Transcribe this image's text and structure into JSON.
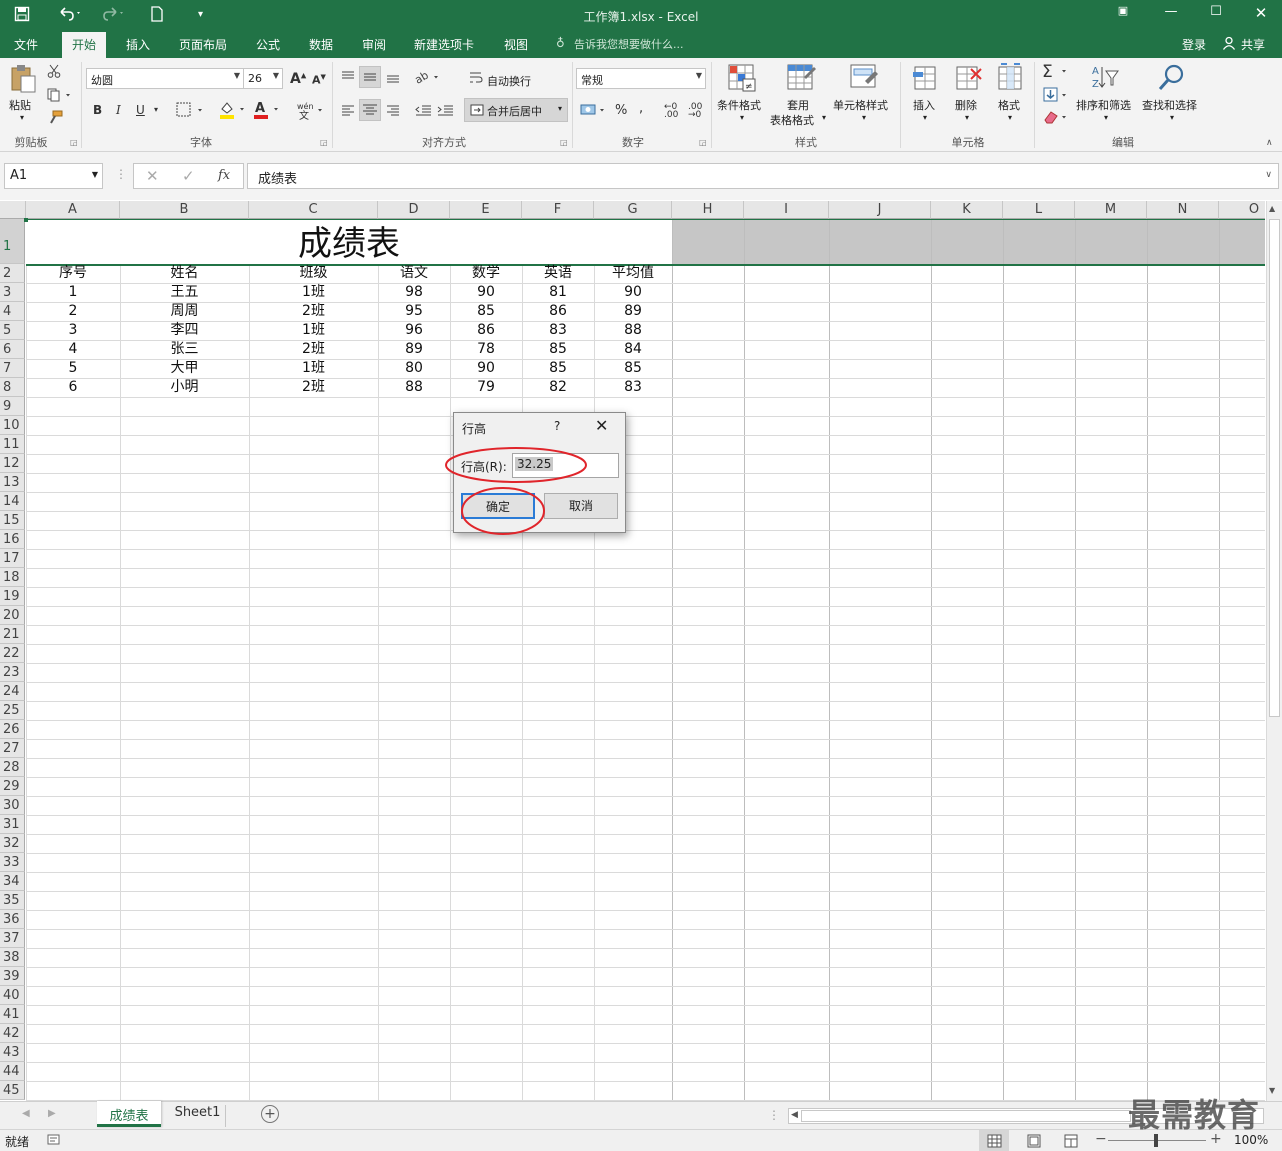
{
  "titlebar": {
    "title": "工作簿1.xlsx - Excel"
  },
  "tabs": [
    "文件",
    "开始",
    "插入",
    "页面布局",
    "公式",
    "数据",
    "审阅",
    "新建选项卡",
    "视图"
  ],
  "tell_me": "告诉我您想要做什么...",
  "account": {
    "login": "登录",
    "share": "共享"
  },
  "ribbon": {
    "paste": "粘贴",
    "font_name": "幼圆",
    "font_size": "26",
    "wrap_text": "自动换行",
    "merge_center": "合并后居中",
    "number_format": "常规",
    "cond_format": "条件格式",
    "table_format_line1": "套用",
    "table_format_line2": "表格格式",
    "cell_styles": "单元格样式",
    "insert": "插入",
    "delete": "删除",
    "format": "格式",
    "sort_filter": "排序和筛选",
    "find_select": "查找和选择",
    "groups": {
      "clipboard": "剪贴板",
      "font": "字体",
      "alignment": "对齐方式",
      "number": "数字",
      "styles": "样式",
      "cells": "单元格",
      "editing": "编辑"
    }
  },
  "formula_bar": {
    "name_box": "A1",
    "fx": "fx",
    "formula": "成绩表"
  },
  "columns": [
    "A",
    "B",
    "C",
    "D",
    "E",
    "F",
    "G",
    "H",
    "I",
    "J",
    "K",
    "L",
    "M",
    "N",
    "O"
  ],
  "sheet": {
    "title": "成绩表",
    "headers": [
      "序号",
      "姓名",
      "班级",
      "语文",
      "数学",
      "英语",
      "平均值"
    ],
    "rows": [
      [
        "1",
        "王五",
        "1班",
        "98",
        "90",
        "81",
        "90"
      ],
      [
        "2",
        "周周",
        "2班",
        "95",
        "85",
        "86",
        "89"
      ],
      [
        "3",
        "李四",
        "1班",
        "96",
        "86",
        "83",
        "88"
      ],
      [
        "4",
        "张三",
        "2班",
        "89",
        "78",
        "85",
        "84"
      ],
      [
        "5",
        "大甲",
        "1班",
        "80",
        "90",
        "85",
        "85"
      ],
      [
        "6",
        "小明",
        "2班",
        "88",
        "79",
        "82",
        "83"
      ]
    ]
  },
  "dialog": {
    "title": "行高",
    "help": "?",
    "label": "行高(R):",
    "value": "32.25",
    "ok": "确定",
    "cancel": "取消"
  },
  "sheet_tabs": [
    "成绩表",
    "Sheet1"
  ],
  "status": {
    "ready": "就绪",
    "zoom": "100%"
  },
  "watermark": "最需教育",
  "colors": {
    "excel_green": "#217346",
    "annotation_red": "#e0252b",
    "highlight_row": "#c6c6c6"
  }
}
